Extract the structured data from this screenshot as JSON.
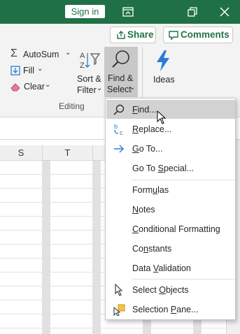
{
  "titlebar": {
    "sign_in_label": "Sign in",
    "icons": [
      "ribbon-display-icon",
      "restore-icon",
      "close-icon"
    ]
  },
  "share": {
    "label": "Share"
  },
  "comments": {
    "label": "Comments"
  },
  "editing_group": {
    "autosum_label": "AutoSum",
    "fill_label": "Fill",
    "clear_label": "Clear",
    "sort_filter_line1": "Sort &",
    "sort_filter_line2": "Filter",
    "find_select_line1": "Find &",
    "find_select_line2": "Select",
    "group_label": "Editing"
  },
  "ideas": {
    "label": "Ideas"
  },
  "columns": [
    "S",
    "T"
  ],
  "menu": {
    "items": [
      {
        "label": "Find...",
        "mnemonic": "F",
        "icon": "search-icon",
        "hovered": true
      },
      {
        "label": "Replace...",
        "mnemonic": "R",
        "icon": "replace-icon"
      },
      {
        "label": "Go To...",
        "mnemonic": "G",
        "icon": "arrow-right-icon"
      },
      {
        "label": "Go To Special...",
        "mnemonic": "S"
      },
      {
        "label": "Formulas",
        "mnemonic": "U"
      },
      {
        "label": "Notes",
        "mnemonic": "N"
      },
      {
        "label": "Conditional Formatting",
        "mnemonic": "C"
      },
      {
        "label": "Constants",
        "mnemonic": "N"
      },
      {
        "label": "Data Validation",
        "mnemonic": "V"
      },
      {
        "label": "Select Objects",
        "mnemonic": "O",
        "icon": "pointer-icon"
      },
      {
        "label": "Selection Pane...",
        "mnemonic": "P",
        "icon": "selection-pane-icon"
      }
    ]
  },
  "colors": {
    "title_green": "#1f7145",
    "accent_green": "#217346",
    "hover_gray": "#d2d2d2",
    "icon_blue": "#2b7cd3"
  }
}
